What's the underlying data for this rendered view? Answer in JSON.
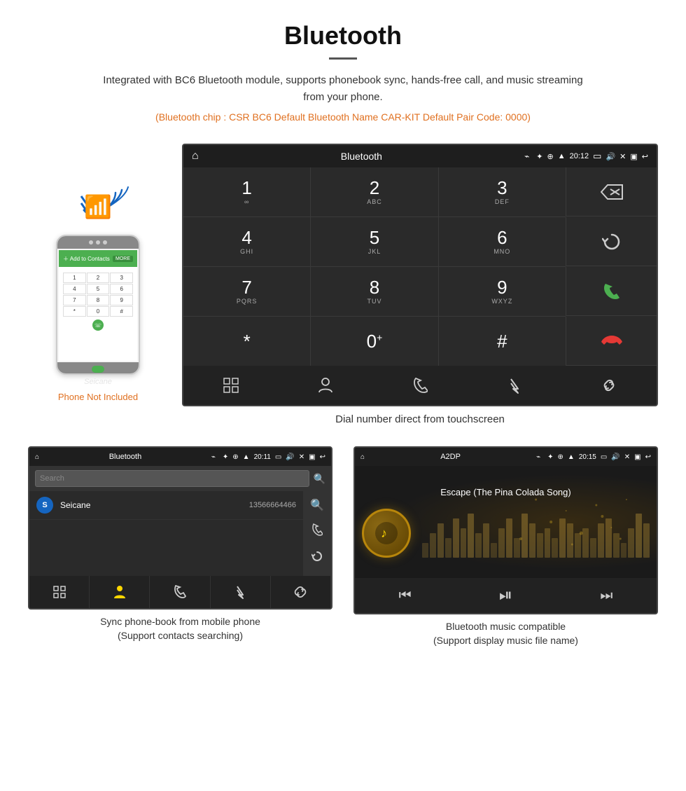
{
  "page": {
    "title": "Bluetooth",
    "divider": true,
    "description": "Integrated with BC6 Bluetooth module, supports phonebook sync, hands-free call, and music streaming from your phone.",
    "specs": "(Bluetooth chip : CSR BC6    Default Bluetooth Name CAR-KIT    Default Pair Code: 0000)"
  },
  "phone_note": "Phone Not Included",
  "car_screen": {
    "status_bar": {
      "title": "Bluetooth",
      "time": "20:12"
    },
    "caption": "Dial number direct from touchscreen",
    "dialpad": {
      "keys": [
        {
          "num": "1",
          "sub": "∞",
          "row": 1,
          "col": 1
        },
        {
          "num": "2",
          "sub": "ABC",
          "row": 1,
          "col": 2
        },
        {
          "num": "3",
          "sub": "DEF",
          "row": 1,
          "col": 3
        },
        {
          "num": "4",
          "sub": "GHI",
          "row": 2,
          "col": 1
        },
        {
          "num": "5",
          "sub": "JKL",
          "row": 2,
          "col": 2
        },
        {
          "num": "6",
          "sub": "MNO",
          "row": 2,
          "col": 3
        },
        {
          "num": "7",
          "sub": "PQRS",
          "row": 3,
          "col": 1
        },
        {
          "num": "8",
          "sub": "TUV",
          "row": 3,
          "col": 2
        },
        {
          "num": "9",
          "sub": "WXYZ",
          "row": 3,
          "col": 3
        },
        {
          "num": "*",
          "sub": "",
          "row": 4,
          "col": 1
        },
        {
          "num": "0",
          "sub": "+",
          "row": 4,
          "col": 2
        },
        {
          "num": "#",
          "sub": "",
          "row": 4,
          "col": 3
        }
      ]
    }
  },
  "phonebook_screen": {
    "status_bar_title": "Bluetooth",
    "status_bar_time": "20:11",
    "search_placeholder": "Search",
    "contacts": [
      {
        "initial": "S",
        "name": "Seicane",
        "number": "13566664466"
      }
    ],
    "caption": "Sync phone-book from mobile phone\n(Support contacts searching)"
  },
  "music_screen": {
    "status_bar_title": "A2DP",
    "status_bar_time": "20:15",
    "song_title": "Escape (The Pina Colada Song)",
    "visualizer_bars": [
      3,
      5,
      7,
      4,
      8,
      6,
      9,
      5,
      7,
      3,
      6,
      8,
      4,
      9,
      7,
      5,
      6,
      4,
      8,
      7,
      5,
      6,
      4,
      7,
      8,
      5,
      3,
      6,
      9,
      7
    ],
    "caption": "Bluetooth music compatible\n(Support display music file name)"
  },
  "icons": {
    "home": "⌂",
    "usb": "⌁",
    "bluetooth": "✦",
    "gps": "◎",
    "wifi": "▲",
    "camera": "📷",
    "volume": "🔊",
    "close_x": "✕",
    "window": "▣",
    "back": "↩",
    "backspace": "⌫",
    "reload": "↺",
    "call_green": "📞",
    "call_red": "📞",
    "grid": "⊞",
    "person": "👤",
    "phone": "📱",
    "bt_small": "✦",
    "link": "🔗",
    "search": "🔍",
    "music_note": "♪",
    "prev": "⏮",
    "play_pause": "⏯",
    "next": "⏭"
  }
}
